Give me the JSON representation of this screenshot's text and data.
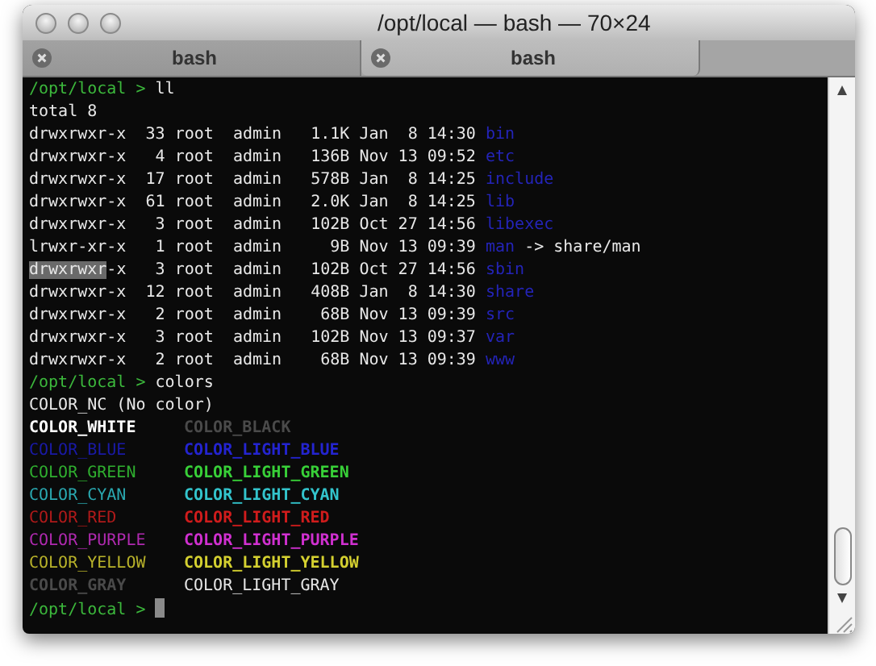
{
  "window": {
    "title": "/opt/local — bash — 70×24"
  },
  "tabs": [
    {
      "label": "bash",
      "selected": false
    },
    {
      "label": "bash",
      "selected": true
    }
  ],
  "terminal": {
    "lines": [
      {
        "kind": "prompt",
        "prompt": "/opt/local >",
        "command": "ll"
      },
      {
        "kind": "text",
        "text": "total 8"
      },
      {
        "kind": "entry",
        "perms": [
          {
            "text": "drwxrwxr-x",
            "selected": false
          }
        ],
        "info": "33 root  admin   1.1K Jan  8 14:30",
        "name": "bin"
      },
      {
        "kind": "entry",
        "perms": [
          {
            "text": "drwxrwxr-x",
            "selected": false
          }
        ],
        "info": " 4 root  admin   136B Nov 13 09:52",
        "name": "etc"
      },
      {
        "kind": "entry",
        "perms": [
          {
            "text": "drwxrwxr-x",
            "selected": false
          }
        ],
        "info": "17 root  admin   578B Jan  8 14:25",
        "name": "include"
      },
      {
        "kind": "entry",
        "perms": [
          {
            "text": "drwxrwxr-x",
            "selected": false
          }
        ],
        "info": "61 root  admin   2.0K Jan  8 14:25",
        "name": "lib"
      },
      {
        "kind": "entry",
        "perms": [
          {
            "text": "drwxrwxr-x",
            "selected": false
          }
        ],
        "info": " 3 root  admin   102B Oct 27 14:56",
        "name": "libexec"
      },
      {
        "kind": "entry",
        "perms": [
          {
            "text": "lrwxr-xr-x",
            "selected": false
          }
        ],
        "info": " 1 root  admin     9B Nov 13 09:39",
        "name": "man",
        "target": "-> share/man"
      },
      {
        "kind": "entry",
        "perms": [
          {
            "text": "drwxrwxr",
            "selected": true
          },
          {
            "text": "-x",
            "selected": false
          }
        ],
        "info": " 3 root  admin   102B Oct 27 14:56",
        "name": "sbin"
      },
      {
        "kind": "entry",
        "perms": [
          {
            "text": "drwxrwxr-x",
            "selected": false
          }
        ],
        "info": "12 root  admin   408B Jan  8 14:30",
        "name": "share"
      },
      {
        "kind": "entry",
        "perms": [
          {
            "text": "drwxrwxr-x",
            "selected": false
          }
        ],
        "info": " 2 root  admin    68B Nov 13 09:39",
        "name": "src"
      },
      {
        "kind": "entry",
        "perms": [
          {
            "text": "drwxrwxr-x",
            "selected": false
          }
        ],
        "info": " 3 root  admin   102B Nov 13 09:37",
        "name": "var"
      },
      {
        "kind": "entry",
        "perms": [
          {
            "text": "drwxrwxr-x",
            "selected": false
          }
        ],
        "info": " 2 root  admin    68B Nov 13 09:39",
        "name": "www"
      },
      {
        "kind": "prompt",
        "prompt": "/opt/local >",
        "command": "colors"
      },
      {
        "kind": "text",
        "text": "COLOR_NC (No color)"
      },
      {
        "kind": "colors",
        "left": {
          "text": "COLOR_WHITE",
          "color": "#ffffff",
          "bold": true
        },
        "right": {
          "text": "COLOR_BLACK",
          "color": "#4a4a4a",
          "bold": true
        }
      },
      {
        "kind": "colors",
        "left": {
          "text": "COLOR_BLUE",
          "color": "#1a1aa8",
          "bold": false
        },
        "right": {
          "text": "COLOR_LIGHT_BLUE",
          "color": "#2424d0",
          "bold": true
        }
      },
      {
        "kind": "colors",
        "left": {
          "text": "COLOR_GREEN",
          "color": "#2fae2f",
          "bold": false
        },
        "right": {
          "text": "COLOR_LIGHT_GREEN",
          "color": "#38d038",
          "bold": true
        }
      },
      {
        "kind": "colors",
        "left": {
          "text": "COLOR_CYAN",
          "color": "#2aa8b0",
          "bold": false
        },
        "right": {
          "text": "COLOR_LIGHT_CYAN",
          "color": "#33c4cc",
          "bold": true
        }
      },
      {
        "kind": "colors",
        "left": {
          "text": "COLOR_RED",
          "color": "#b01a1a",
          "bold": false
        },
        "right": {
          "text": "COLOR_LIGHT_RED",
          "color": "#d01c1c",
          "bold": true
        }
      },
      {
        "kind": "colors",
        "left": {
          "text": "COLOR_PURPLE",
          "color": "#b02ab0",
          "bold": false
        },
        "right": {
          "text": "COLOR_LIGHT_PURPLE",
          "color": "#d030d0",
          "bold": true
        }
      },
      {
        "kind": "colors",
        "left": {
          "text": "COLOR_YELLOW",
          "color": "#b8b22a",
          "bold": false
        },
        "right": {
          "text": "COLOR_LIGHT_YELLOW",
          "color": "#d4d030",
          "bold": true
        }
      },
      {
        "kind": "colors",
        "left": {
          "text": "COLOR_GRAY",
          "color": "#4a4a4a",
          "bold": true
        },
        "right": {
          "text": "COLOR_LIGHT_GRAY",
          "color": "#e6e6e6",
          "bold": false
        }
      },
      {
        "kind": "prompt",
        "prompt": "/opt/local >",
        "cursor": true
      }
    ]
  }
}
